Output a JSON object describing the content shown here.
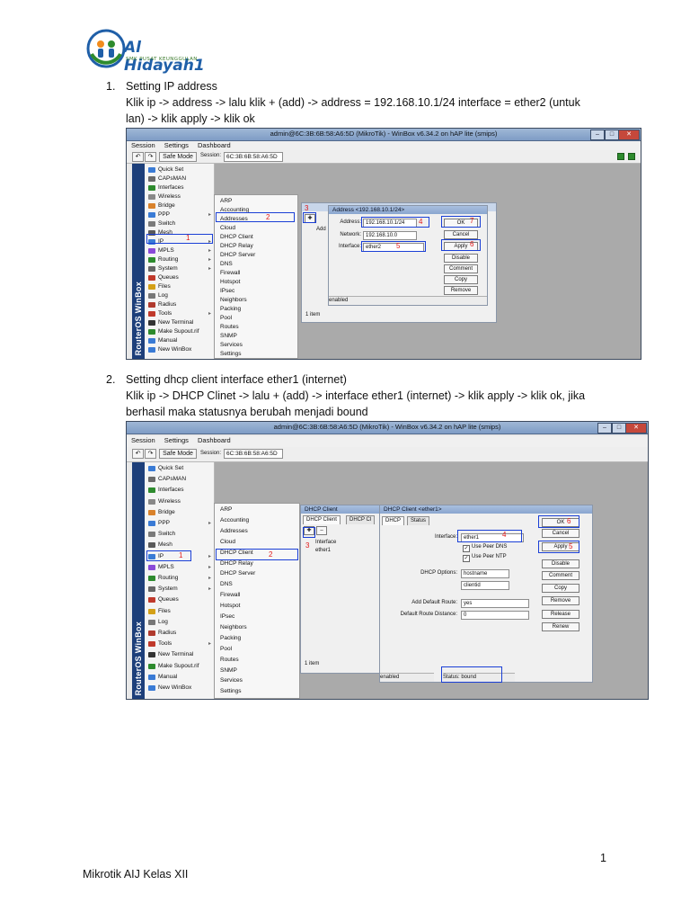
{
  "header": {
    "logo_title": "Al Hidayah1",
    "logo_subtitle": "SMK PUSAT KEUNGGULAN"
  },
  "steps": [
    {
      "number": "1.",
      "title": "Setting IP address",
      "line1": "Klik ip -> address -> lalu klik + (add) -> address = 192.168.10.1/24 interface = ether2 (untuk",
      "line2": "lan) -> klik apply -> klik ok"
    },
    {
      "number": "2.",
      "title": "Setting dhcp client interface ether1 (internet)",
      "line1": "Klik ip -> DHCP Clinet -> lalu + (add) -> interface ether1 (internet) -> klik apply -> klik ok, jika",
      "line2": "berhasil maka statusnya berubah menjadi bound"
    }
  ],
  "footer": {
    "page_number": "1",
    "label": "Mikrotik AIJ Kelas XII"
  },
  "winbox": {
    "title1": "admin@6C:3B:6B:58:A6:5D (MikroTik) - WinBox v6.34.2 on hAP lite (smips)",
    "title2": "admin@6C:3B:6B:58:A6:5D (MikroTik) - WinBox v6.34.2 on hAP lite (smips)",
    "menubar": [
      "Session",
      "Settings",
      "Dashboard"
    ],
    "safe_mode": "Safe Mode",
    "session_label": "Session:",
    "session_value": "6C:3B:6B:58:A6:5D",
    "sidebar_text": "RouterOS WinBox",
    "menu_items": [
      "Quick Set",
      "CAPsMAN",
      "Interfaces",
      "Wireless",
      "Bridge",
      "PPP",
      "Switch",
      "Mesh",
      "IP",
      "MPLS",
      "Routing",
      "System",
      "Queues",
      "Files",
      "Log",
      "Radius",
      "Tools",
      "New Terminal",
      "Make Supout.rif",
      "Manual",
      "New WinBox"
    ],
    "submenu_items": [
      "ARP",
      "Accounting",
      "Addresses",
      "Cloud",
      "DHCP Client",
      "DHCP Relay",
      "DHCP Server",
      "DNS",
      "Firewall",
      "Hotspot",
      "IPsec",
      "Neighbors",
      "Packing",
      "Pool",
      "Routes",
      "SNMP",
      "Services",
      "Settings"
    ]
  },
  "shot1": {
    "address_window_title": "Address <192.168.10.1/24>",
    "address_label": "Address:",
    "address_value": "192.168.10.1/24",
    "network_label": "Network:",
    "network_value": "192.168.10.0",
    "interface_label": "Interface:",
    "interface_value": "ether2",
    "btn_ok": "OK",
    "btn_cancel": "Cancel",
    "btn_apply": "Apply",
    "btn_disable": "Disable",
    "btn_comment": "Comment",
    "btn_copy": "Copy",
    "btn_remove": "Remove",
    "status_enabled": "enabled",
    "items_count": "1 item",
    "addr_col": "Add",
    "num_1": "1",
    "num_2": "2",
    "num_3": "3",
    "num_4": "4",
    "num_5": "5",
    "num_6": "6",
    "num_7": "7"
  },
  "shot2": {
    "list_title": "DHCP Client",
    "tab_dhcp_client": "DHCP Client",
    "tab_dhcp_client_options": "DHCP Cl",
    "col_interface": "Interface",
    "row_interface": "ether1",
    "items_count": "1 item",
    "window_title": "DHCP Client <ether1>",
    "tab_dhcp": "DHCP",
    "tab_status": "Status",
    "interface_label": "Interface:",
    "interface_value": "ether1",
    "use_peer_dns": "Use Peer DNS",
    "use_peer_ntp": "Use Peer NTP",
    "dhcp_options_label": "DHCP Options:",
    "dhcp_option_1": "hostname",
    "dhcp_option_2": "clientid",
    "add_default_route_label": "Add Default Route:",
    "add_default_route_value": "yes",
    "default_route_distance_label": "Default Route Distance:",
    "default_route_distance_value": "0",
    "btn_ok": "OK",
    "btn_cancel": "Cancel",
    "btn_apply": "Apply",
    "btn_disable": "Disable",
    "btn_comment": "Comment",
    "btn_copy": "Copy",
    "btn_remove": "Remove",
    "btn_release": "Release",
    "btn_renew": "Renew",
    "status_enabled": "enabled",
    "status_bound": "Status: bound",
    "num_1": "1",
    "num_2": "2",
    "num_3": "3",
    "num_4": "4",
    "num_5": "5",
    "num_6": "6"
  }
}
